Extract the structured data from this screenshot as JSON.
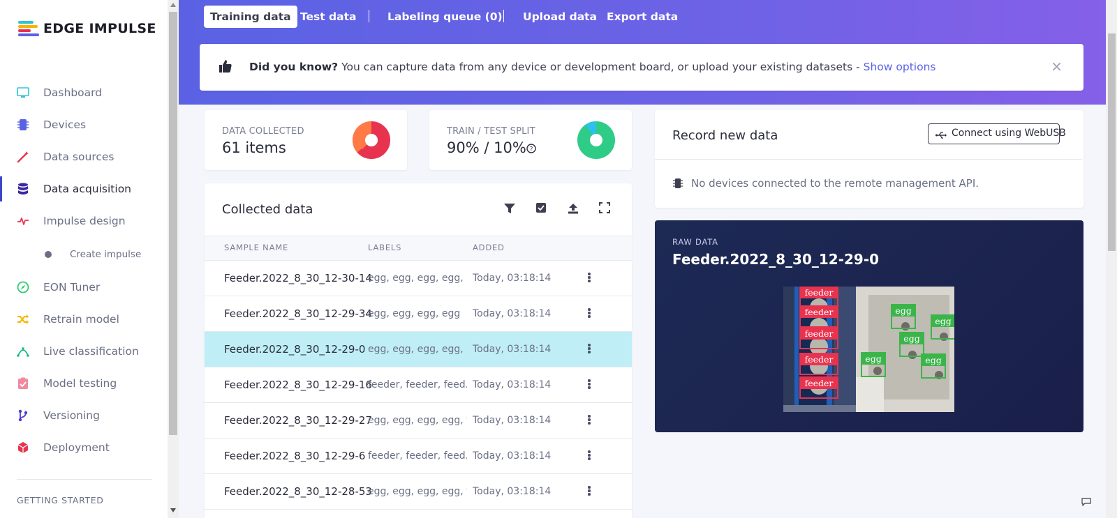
{
  "app": {
    "logo_text": "EDGE IMPULSE"
  },
  "sidebar": {
    "items": [
      {
        "label": "Dashboard",
        "icon": "monitor-icon",
        "color": "#2ec5d3"
      },
      {
        "label": "Devices",
        "icon": "chip-icon",
        "color": "#5a62e3"
      },
      {
        "label": "Data sources",
        "icon": "wand-icon",
        "color": "#e8334f"
      },
      {
        "label": "Data acquisition",
        "icon": "database-icon",
        "color": "#3b2a9f",
        "active": true
      },
      {
        "label": "Impulse design",
        "icon": "pulse-icon",
        "color": "#e8334f"
      },
      {
        "label": "Create impulse",
        "icon": "dot-icon",
        "sub": true
      },
      {
        "label": "EON Tuner",
        "icon": "compass-icon",
        "color": "#2ecc71"
      },
      {
        "label": "Retrain model",
        "icon": "shuffle-icon",
        "color": "#f5b400"
      },
      {
        "label": "Live classification",
        "icon": "node-icon",
        "color": "#1fb98a"
      },
      {
        "label": "Model testing",
        "icon": "clipboard-check-icon",
        "color": "#f08aa0"
      },
      {
        "label": "Versioning",
        "icon": "branch-icon",
        "color": "#4a3bd1"
      },
      {
        "label": "Deployment",
        "icon": "cube-icon",
        "color": "#e8334f"
      }
    ],
    "section_heading": "GETTING STARTED"
  },
  "tabs": [
    {
      "label": "Training data",
      "active": true
    },
    {
      "label": "Test data"
    },
    {
      "label": "Labeling queue (0)"
    },
    {
      "label": "Upload data"
    },
    {
      "label": "Export data"
    }
  ],
  "notice": {
    "bold": "Did you know?",
    "text": " You can capture data from any device or development board, or upload your existing datasets - ",
    "link": "Show options",
    "close": "×"
  },
  "stats": {
    "data_collected": {
      "label": "DATA COLLECTED",
      "value": "61 items"
    },
    "split": {
      "label": "TRAIN / TEST SPLIT",
      "value": "90% / 10%",
      "help_icon": "question-icon"
    }
  },
  "collected": {
    "title": "Collected data",
    "tools": [
      "filter-icon",
      "check-square-icon",
      "upload-icon",
      "expand-icon"
    ],
    "columns": [
      "SAMPLE NAME",
      "LABELS",
      "ADDED"
    ],
    "rows": [
      {
        "name": "Feeder.2022_8_30_12-30-14",
        "labels": "egg, egg, egg, egg, e...",
        "added": "Today, 03:18:14"
      },
      {
        "name": "Feeder.2022_8_30_12-29-34",
        "labels": "egg, egg, egg, egg",
        "added": "Today, 03:18:14"
      },
      {
        "name": "Feeder.2022_8_30_12-29-0",
        "labels": "egg, egg, egg, egg, e...",
        "added": "Today, 03:18:14",
        "selected": true
      },
      {
        "name": "Feeder.2022_8_30_12-29-16",
        "labels": "feeder, feeder, feed...",
        "added": "Today, 03:18:14"
      },
      {
        "name": "Feeder.2022_8_30_12-29-27",
        "labels": "egg, egg, egg, egg, f...",
        "added": "Today, 03:18:14"
      },
      {
        "name": "Feeder.2022_8_30_12-29-6",
        "labels": "feeder, feeder, feed...",
        "added": "Today, 03:18:14"
      },
      {
        "name": "Feeder.2022_8_30_12-28-53",
        "labels": "egg, egg, egg, egg, f...",
        "added": "Today, 03:18:14"
      }
    ]
  },
  "record": {
    "title": "Record new data",
    "webusb_button": "Connect using WebUSB",
    "no_devices": "No devices connected to the remote management API."
  },
  "raw": {
    "label": "RAW DATA",
    "title": "Feeder.2022_8_30_12-29-0",
    "boxes": [
      {
        "label": "feeder"
      },
      {
        "label": "feeder"
      },
      {
        "label": "feeder"
      },
      {
        "label": "feeder"
      },
      {
        "label": "feeder"
      },
      {
        "label": "egg"
      },
      {
        "label": "egg"
      },
      {
        "label": "egg"
      },
      {
        "label": "egg"
      },
      {
        "label": "egg"
      }
    ]
  },
  "colors": {
    "accent": "#5a62e3",
    "selected_row": "#bfeef7",
    "feeder_box": "#e8334f",
    "egg_box": "#3bb54a"
  }
}
